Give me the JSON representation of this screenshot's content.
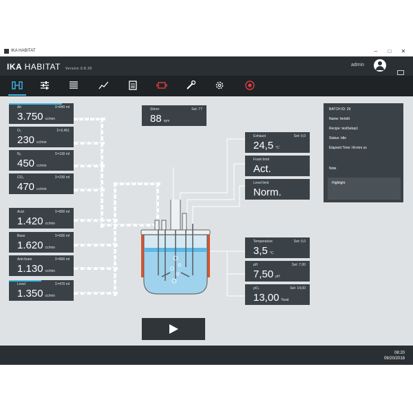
{
  "window": {
    "title": "IKA HABITAT",
    "controls": [
      "–",
      "□",
      "✕"
    ]
  },
  "header": {
    "brand": "IKA",
    "product": "HABITAT",
    "version": "Version 0.8.20",
    "user": "admin"
  },
  "toolbar": {
    "icons": [
      "overview-icon",
      "settings-sliders-icon",
      "list-icon",
      "trend-chart-icon",
      "clipboard-icon",
      "motor-icon",
      "wrench-icon",
      "gear-icon",
      "record-icon"
    ]
  },
  "left_panels": [
    {
      "name": "Air",
      "sum": "Σ=840 ml",
      "value": "3.750",
      "unit": "cc/min",
      "fill": 0.82
    },
    {
      "name": "O₂",
      "sum": "Σ=2,451",
      "value": "230",
      "unit": "cc/min",
      "fill": 0.0
    },
    {
      "name": "N₂",
      "sum": "Σ=130 ml",
      "value": "450",
      "unit": "cc/min",
      "fill": 0.0
    },
    {
      "name": "CO₂",
      "sum": "Σ=230 ml",
      "value": "470",
      "unit": "cc/min",
      "fill": 0.0
    },
    {
      "name": "Acid",
      "sum": "Σ=800 ml",
      "value": "1.420",
      "unit": "cc/min",
      "fill": 0.0
    },
    {
      "name": "Base",
      "sum": "Σ=600 ml",
      "value": "1.620",
      "unit": "cc/min",
      "fill": 0.0
    },
    {
      "name": "Anti-foam",
      "sum": "Σ=800 ml",
      "value": "1.130",
      "unit": "cc/min",
      "fill": 0.0
    },
    {
      "name": "Level",
      "sum": "Σ=470 ml",
      "value": "1.350",
      "unit": "cc/min",
      "fill": 0.5
    }
  ],
  "stirrer": {
    "name": "Stirrer",
    "set": "Set: 77",
    "value": "88",
    "unit": "rpm"
  },
  "right_top": [
    {
      "name": "Exhaust",
      "set": "Set: 0,0",
      "value": "24,5",
      "unit": "°C"
    },
    {
      "name": "Foam limit",
      "set": "",
      "value": "Act.",
      "unit": ""
    },
    {
      "name": "Level limit",
      "set": "",
      "value": "Norm.",
      "unit": ""
    }
  ],
  "right_bottom": [
    {
      "name": "Temperature",
      "set": "Set: 0,0",
      "value": "3,5",
      "unit": "°C"
    },
    {
      "name": "pH",
      "set": "Set: 7,00",
      "value": "7,50",
      "unit": "pH"
    },
    {
      "name": "pO₂",
      "set": "Set: 14,00",
      "value": "13,00",
      "unit": "%sat"
    }
  ],
  "info": {
    "batch": "BATCH ID: 29",
    "name": "Name: fertoltt",
    "recipe": "Recipe: testSetup1",
    "status": "Status: Idle",
    "elapsed": "Elapsed Time: hh:mm.ss",
    "note_label": "Note",
    "note_text": "Highlight"
  },
  "statusbar": {
    "time": "08:20",
    "date": "09/20/2018"
  }
}
